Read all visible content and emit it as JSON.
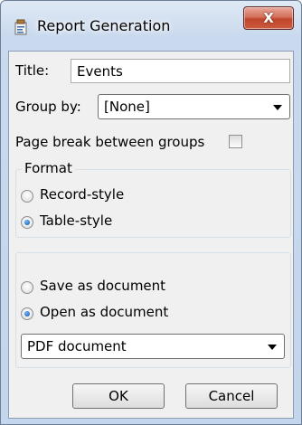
{
  "window": {
    "title": "Report Generation",
    "close_glyph": "X",
    "app_icon": "report-icon"
  },
  "form": {
    "title_label": "Title:",
    "title_value": "Events",
    "group_by_label": "Group by:",
    "group_by_value": "[None]",
    "page_break_label": "Page break between groups",
    "page_break_checked": false
  },
  "format": {
    "legend": "Format",
    "options": [
      {
        "label": "Record-style",
        "checked": false
      },
      {
        "label": "Table-style",
        "checked": true
      }
    ]
  },
  "output": {
    "options": [
      {
        "label": "Save as document",
        "checked": false
      },
      {
        "label": "Open as document",
        "checked": true
      }
    ],
    "document_type": "PDF document"
  },
  "buttons": {
    "ok": "OK",
    "cancel": "Cancel"
  },
  "colors": {
    "close_button": "#c2462c",
    "radio_selected": "#0b4f9c"
  }
}
